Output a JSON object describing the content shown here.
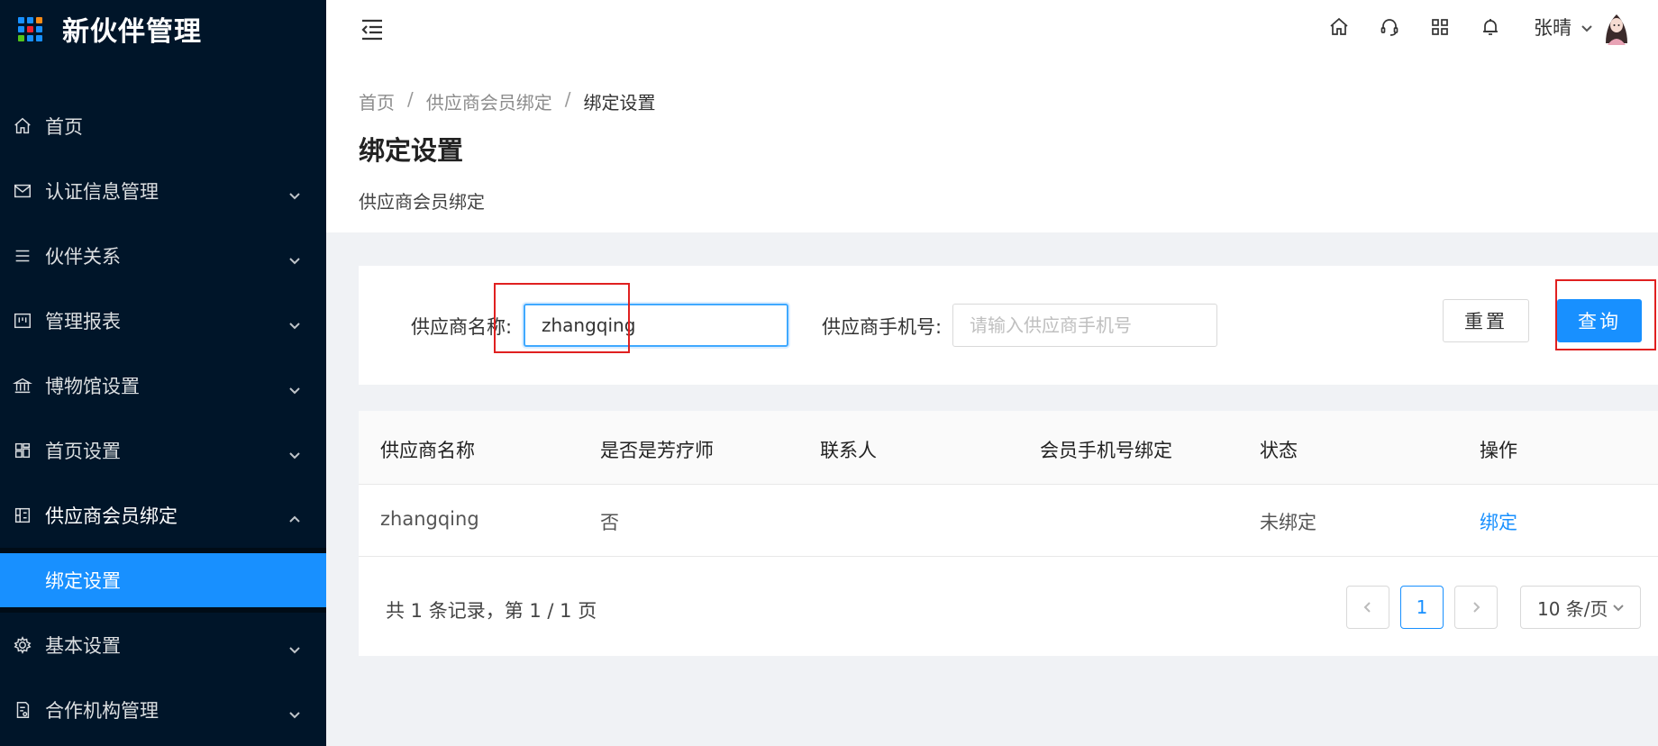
{
  "app": {
    "title": "新伙伴管理"
  },
  "colors": {
    "sidebar_bg": "#001529",
    "accent": "#1890ff",
    "highlight_box": "#e02020"
  },
  "sidebar": {
    "items": [
      {
        "label": "首页",
        "icon": "home-icon",
        "has_children": false
      },
      {
        "label": "认证信息管理",
        "icon": "mail-icon",
        "has_children": true
      },
      {
        "label": "伙伴关系",
        "icon": "list-icon",
        "has_children": true
      },
      {
        "label": "管理报表",
        "icon": "report-icon",
        "has_children": true
      },
      {
        "label": "博物馆设置",
        "icon": "bank-icon",
        "has_children": true
      },
      {
        "label": "首页设置",
        "icon": "layout-icon",
        "has_children": true
      },
      {
        "label": "供应商会员绑定",
        "icon": "scan-icon",
        "has_children": true,
        "open": true
      },
      {
        "label": "基本设置",
        "icon": "gear-icon",
        "has_children": true
      },
      {
        "label": "合作机构管理",
        "icon": "audit-icon",
        "has_children": true
      }
    ],
    "active_subitem": "绑定设置"
  },
  "header": {
    "user_name": "张晴",
    "icons": [
      "home-icon",
      "headset-icon",
      "apps-icon",
      "bell-icon"
    ]
  },
  "breadcrumb": [
    "首页",
    "供应商会员绑定",
    "绑定设置"
  ],
  "page": {
    "title": "绑定设置",
    "description": "供应商会员绑定"
  },
  "search": {
    "name_label": "供应商名称:",
    "name_value": "zhangqing",
    "phone_label": "供应商手机号:",
    "phone_placeholder": "请输入供应商手机号",
    "reset_label": "重置",
    "query_label": "查询"
  },
  "table": {
    "columns": [
      "供应商名称",
      "是否是芳疗师",
      "联系人",
      "会员手机号绑定",
      "状态",
      "操作"
    ],
    "rows": [
      {
        "name": "zhangqing",
        "is_therapist": "否",
        "contact": "",
        "phone_bind": "",
        "status": "未绑定",
        "action": "绑定"
      }
    ]
  },
  "pagination": {
    "summary": "共 1 条记录，第 1 / 1 页",
    "current_page": "1",
    "page_size": "10 条/页"
  }
}
